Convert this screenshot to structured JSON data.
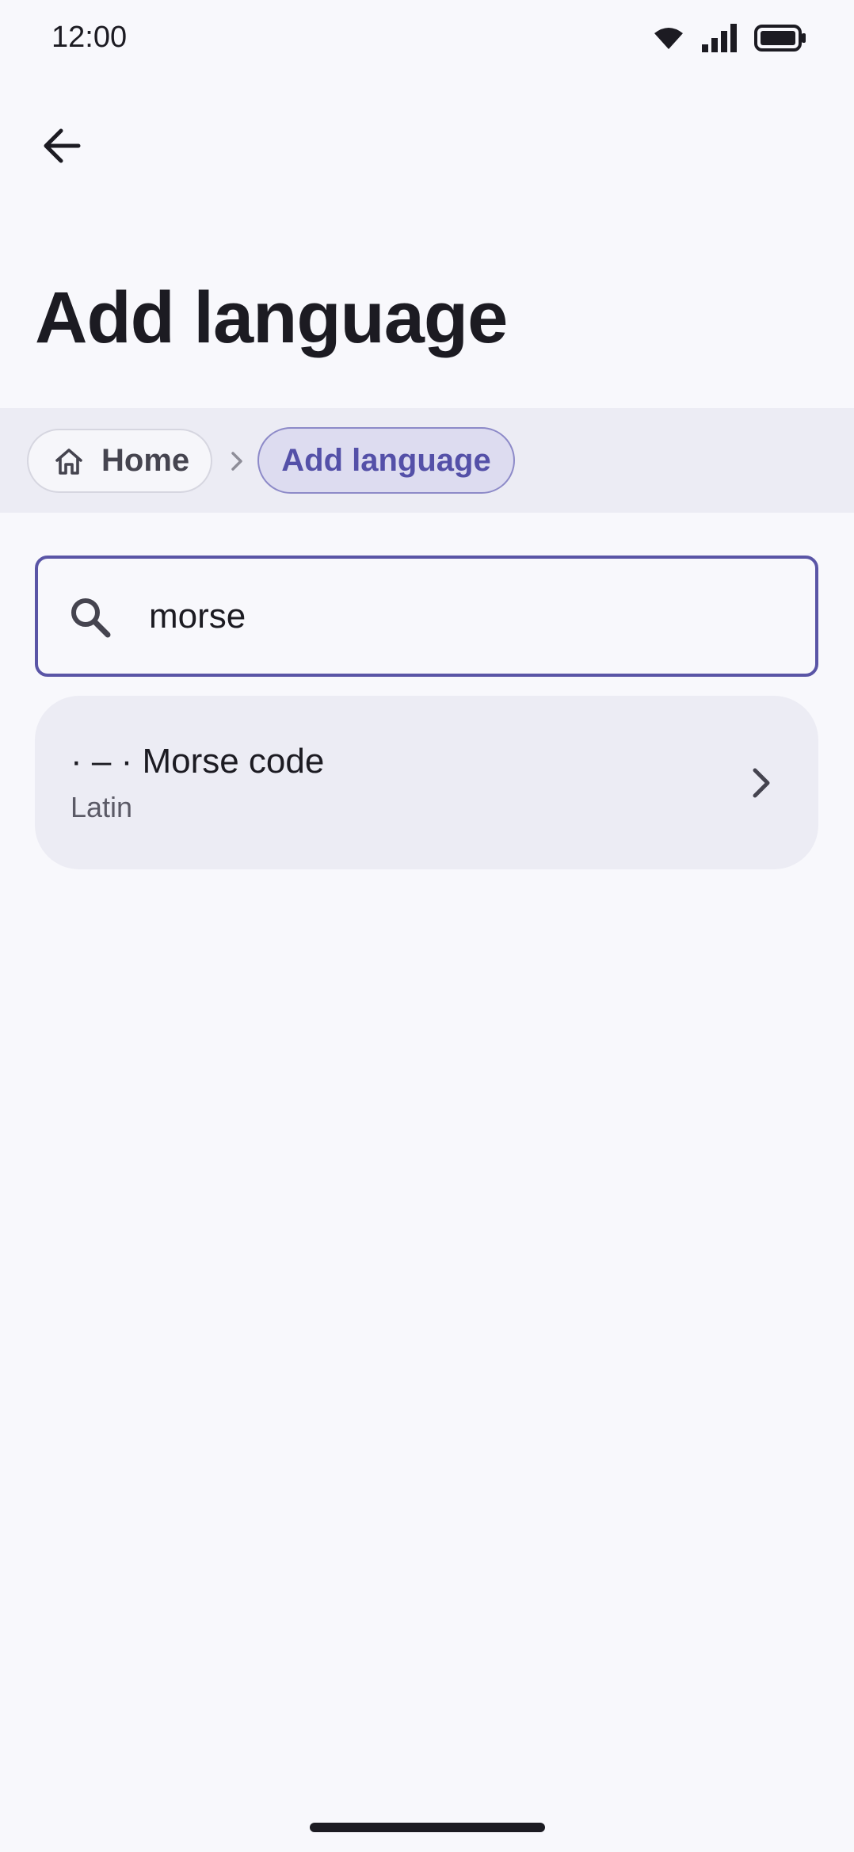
{
  "status_bar": {
    "time": "12:00",
    "icons": [
      "wifi-icon",
      "signal-icon",
      "battery-icon"
    ]
  },
  "app_bar": {
    "back_icon": "arrow-left-icon",
    "title": "Add language"
  },
  "breadcrumb": {
    "items": [
      {
        "label": "Home",
        "icon": "home-icon"
      },
      {
        "label": "Add language"
      }
    ],
    "separator_icon": "chevron-right-icon"
  },
  "search": {
    "value": "morse",
    "icon": "search-icon"
  },
  "results": [
    {
      "title": "· – · Morse code",
      "subtitle": "Latin",
      "icon": "chevron-right-icon"
    }
  ],
  "colors": {
    "background": "#f8f8fc",
    "surface": "#ececf4",
    "accent": "#5a55a6",
    "accent_container": "#dddcf0",
    "text": "#1c1b22"
  }
}
